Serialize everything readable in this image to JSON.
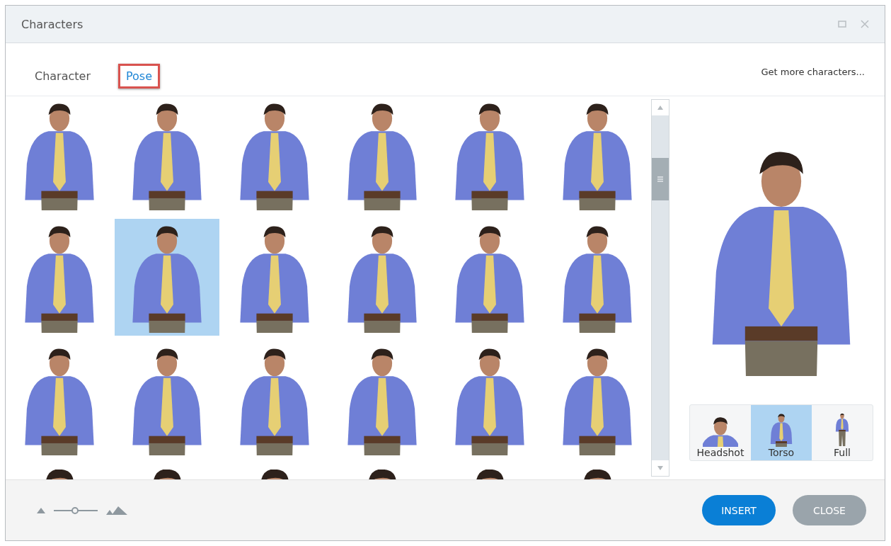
{
  "window": {
    "title": "Characters"
  },
  "tabs": [
    {
      "label": "Character",
      "selected": false
    },
    {
      "label": "Pose",
      "selected": true
    }
  ],
  "get_more_link": "Get more characters...",
  "poses": [
    {
      "selected": false
    },
    {
      "selected": false
    },
    {
      "selected": false
    },
    {
      "selected": false
    },
    {
      "selected": false
    },
    {
      "selected": false
    },
    {
      "selected": false
    },
    {
      "selected": true
    },
    {
      "selected": false
    },
    {
      "selected": false
    },
    {
      "selected": false
    },
    {
      "selected": false
    },
    {
      "selected": false
    },
    {
      "selected": false
    },
    {
      "selected": false
    },
    {
      "selected": false
    },
    {
      "selected": false
    },
    {
      "selected": false
    },
    {
      "selected": false
    },
    {
      "selected": false
    },
    {
      "selected": false
    },
    {
      "selected": false
    },
    {
      "selected": false
    },
    {
      "selected": false
    }
  ],
  "view_options": [
    {
      "label": "Headshot",
      "kind": "headshot",
      "selected": false
    },
    {
      "label": "Torso",
      "kind": "torso",
      "selected": true
    },
    {
      "label": "Full",
      "kind": "full",
      "selected": false
    }
  ],
  "size_slider": {
    "level": 0.48
  },
  "buttons": [
    {
      "label": "INSERT",
      "kind": "primary"
    },
    {
      "label": "CLOSE",
      "kind": "secondary"
    }
  ]
}
